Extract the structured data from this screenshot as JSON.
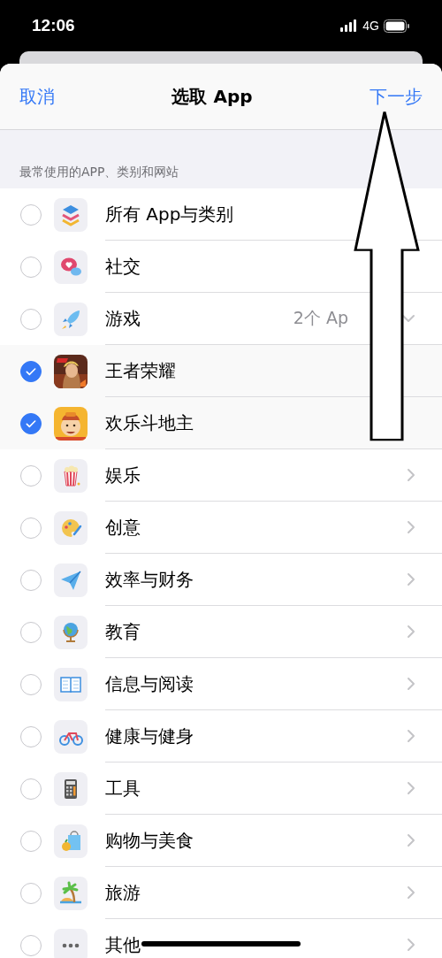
{
  "status_bar": {
    "time": "12:06",
    "network": "4G"
  },
  "nav": {
    "cancel": "取消",
    "title": "选取 App",
    "next": "下一步"
  },
  "section_header": "最常使用的APP、类别和网站",
  "categories": [
    {
      "label": "所有 App与类别",
      "checked": false,
      "chevron": false
    },
    {
      "label": "社交",
      "checked": false,
      "chevron": false
    },
    {
      "label": "游戏",
      "checked": false,
      "chevron": true,
      "expanded": true,
      "count": "2个 Ap",
      "children": [
        {
          "label": "王者荣耀",
          "checked": true
        },
        {
          "label": "欢乐斗地主",
          "checked": true
        }
      ]
    },
    {
      "label": "娱乐",
      "checked": false,
      "chevron": true
    },
    {
      "label": "创意",
      "checked": false,
      "chevron": true
    },
    {
      "label": "效率与财务",
      "checked": false,
      "chevron": true
    },
    {
      "label": "教育",
      "checked": false,
      "chevron": true
    },
    {
      "label": "信息与阅读",
      "checked": false,
      "chevron": true
    },
    {
      "label": "健康与健身",
      "checked": false,
      "chevron": true
    },
    {
      "label": "工具",
      "checked": false,
      "chevron": true
    },
    {
      "label": "购物与美食",
      "checked": false,
      "chevron": true
    },
    {
      "label": "旅游",
      "checked": false,
      "chevron": true
    },
    {
      "label": "其他",
      "checked": false,
      "chevron": true
    }
  ]
}
